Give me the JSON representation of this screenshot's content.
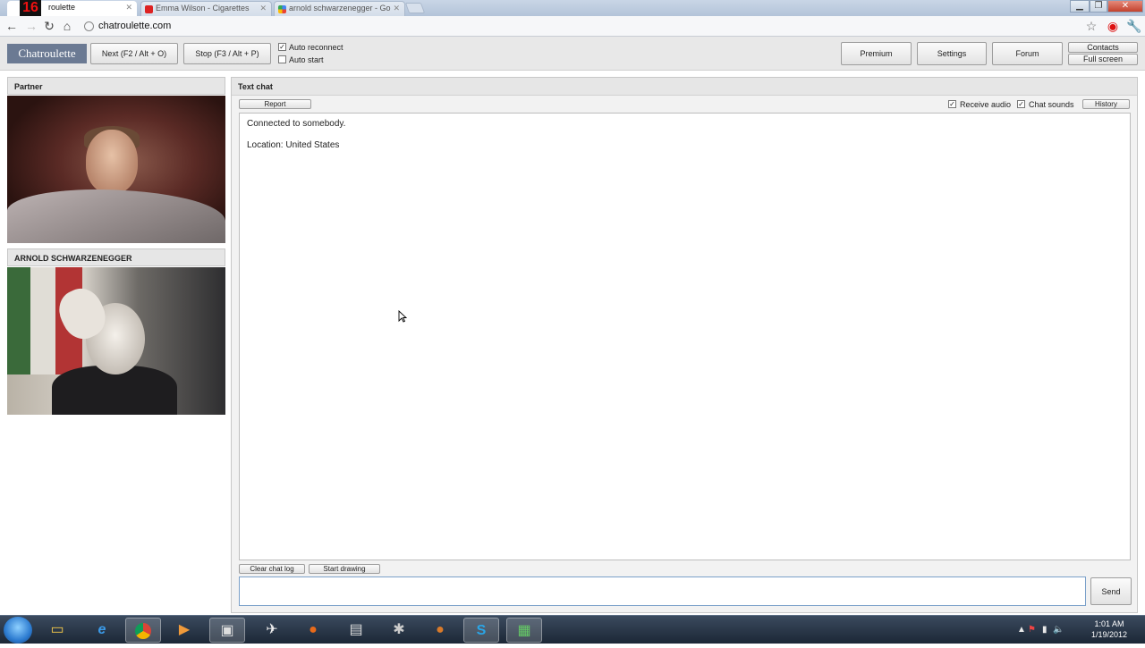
{
  "browser": {
    "badge": "16",
    "tabs": [
      {
        "title": "roulette",
        "active": true
      },
      {
        "title": "Emma Wilson - Cigarettes",
        "active": false
      },
      {
        "title": "arnold schwarzenegger - Go",
        "active": false
      }
    ],
    "url": "chatroulette.com"
  },
  "site": {
    "logo": "Chatroulette",
    "next_label": "Next (F2 / Alt + O)",
    "stop_label": "Stop (F3 / Alt + P)",
    "auto_reconnect_label": "Auto reconnect",
    "auto_reconnect_checked": true,
    "auto_start_label": "Auto start",
    "auto_start_checked": false,
    "premium_label": "Premium",
    "settings_label": "Settings",
    "forum_label": "Forum",
    "contacts_label": "Contacts",
    "fullscreen_label": "Full screen"
  },
  "partner": {
    "heading": "Partner"
  },
  "self": {
    "heading": "ARNOLD SCHWARZENEGGER"
  },
  "chat": {
    "heading": "Text chat",
    "report_label": "Report",
    "receive_audio_label": "Receive audio",
    "receive_audio_checked": true,
    "chat_sounds_label": "Chat sounds",
    "chat_sounds_checked": true,
    "history_label": "History",
    "messages": [
      "Connected to somebody.",
      "Location: United States"
    ],
    "clear_label": "Clear chat log",
    "drawing_label": "Start drawing",
    "input_value": "",
    "send_label": "Send"
  },
  "taskbar": {
    "time": "1:01 AM",
    "date": "1/19/2012"
  },
  "colors": {
    "logo_bg": "#6b7a93",
    "input_border": "#7aa0c9"
  }
}
